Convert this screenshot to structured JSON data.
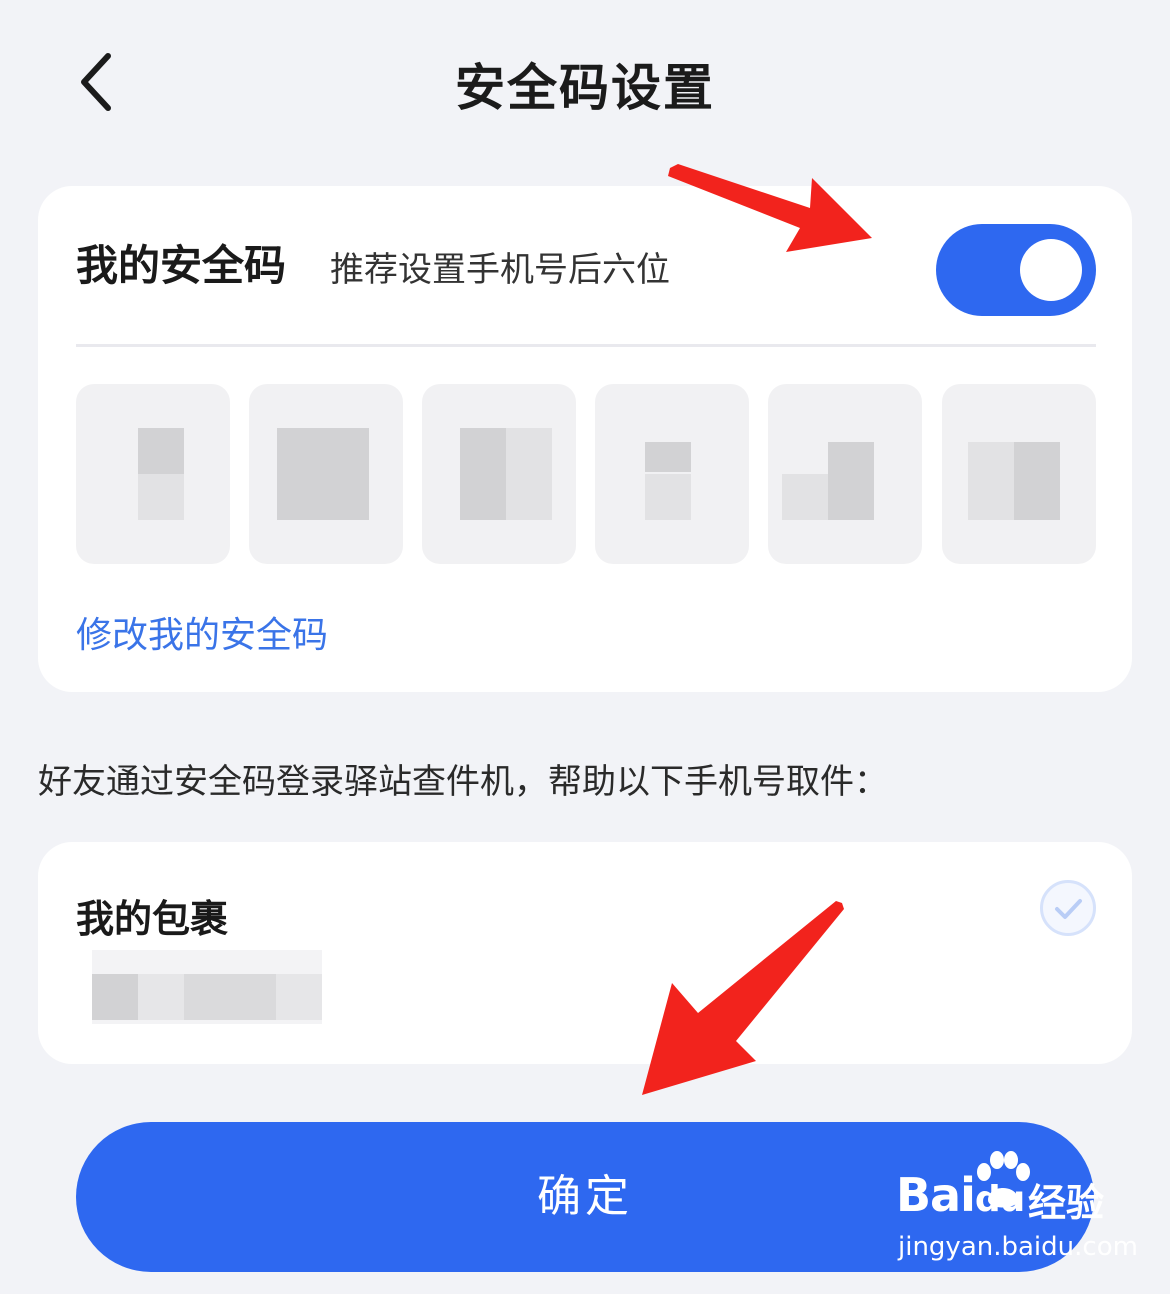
{
  "header": {
    "title": "安全码设置"
  },
  "security_code": {
    "title": "我的安全码",
    "hint": "推荐设置手机号后六位",
    "enabled": true,
    "edit_link": "修改我的安全码",
    "digit_count": 6
  },
  "description": "好友通过安全码登录驿站查件机，帮助以下手机号取件：",
  "packages": {
    "title": "我的包裹",
    "selected": true
  },
  "confirm_label": "确定",
  "watermark": {
    "brand": "Bai",
    "brand_du": "du",
    "cn": "经验",
    "url": "jingyan.baidu.com"
  },
  "colors": {
    "accent": "#2e68f0",
    "link": "#3a74e8",
    "background": "#f2f3f7",
    "annotation_arrow": "#f2231d"
  }
}
